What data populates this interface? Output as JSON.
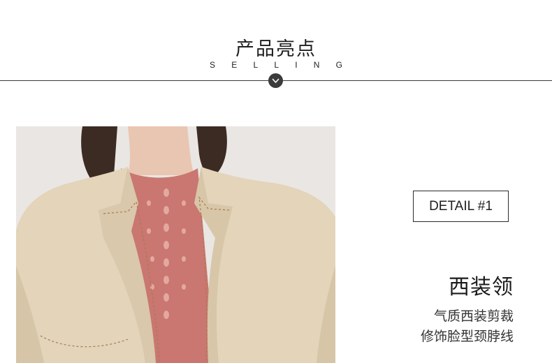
{
  "header": {
    "title_cn": "产品亮点",
    "title_en_letters": [
      "S",
      "E",
      "L",
      "L",
      "I",
      "N",
      "G"
    ]
  },
  "detail": {
    "badge": "DETAIL #1",
    "heading": "西装领",
    "lines": [
      "气质西装剪裁",
      "修饰脸型颈脖线"
    ]
  },
  "colors": {
    "rule": "#3a3a3a",
    "chevron_bg": "#3b3b3b",
    "jacket": "#e2d3b8",
    "blouse": "#c97770",
    "hair": "#3a2a22"
  }
}
